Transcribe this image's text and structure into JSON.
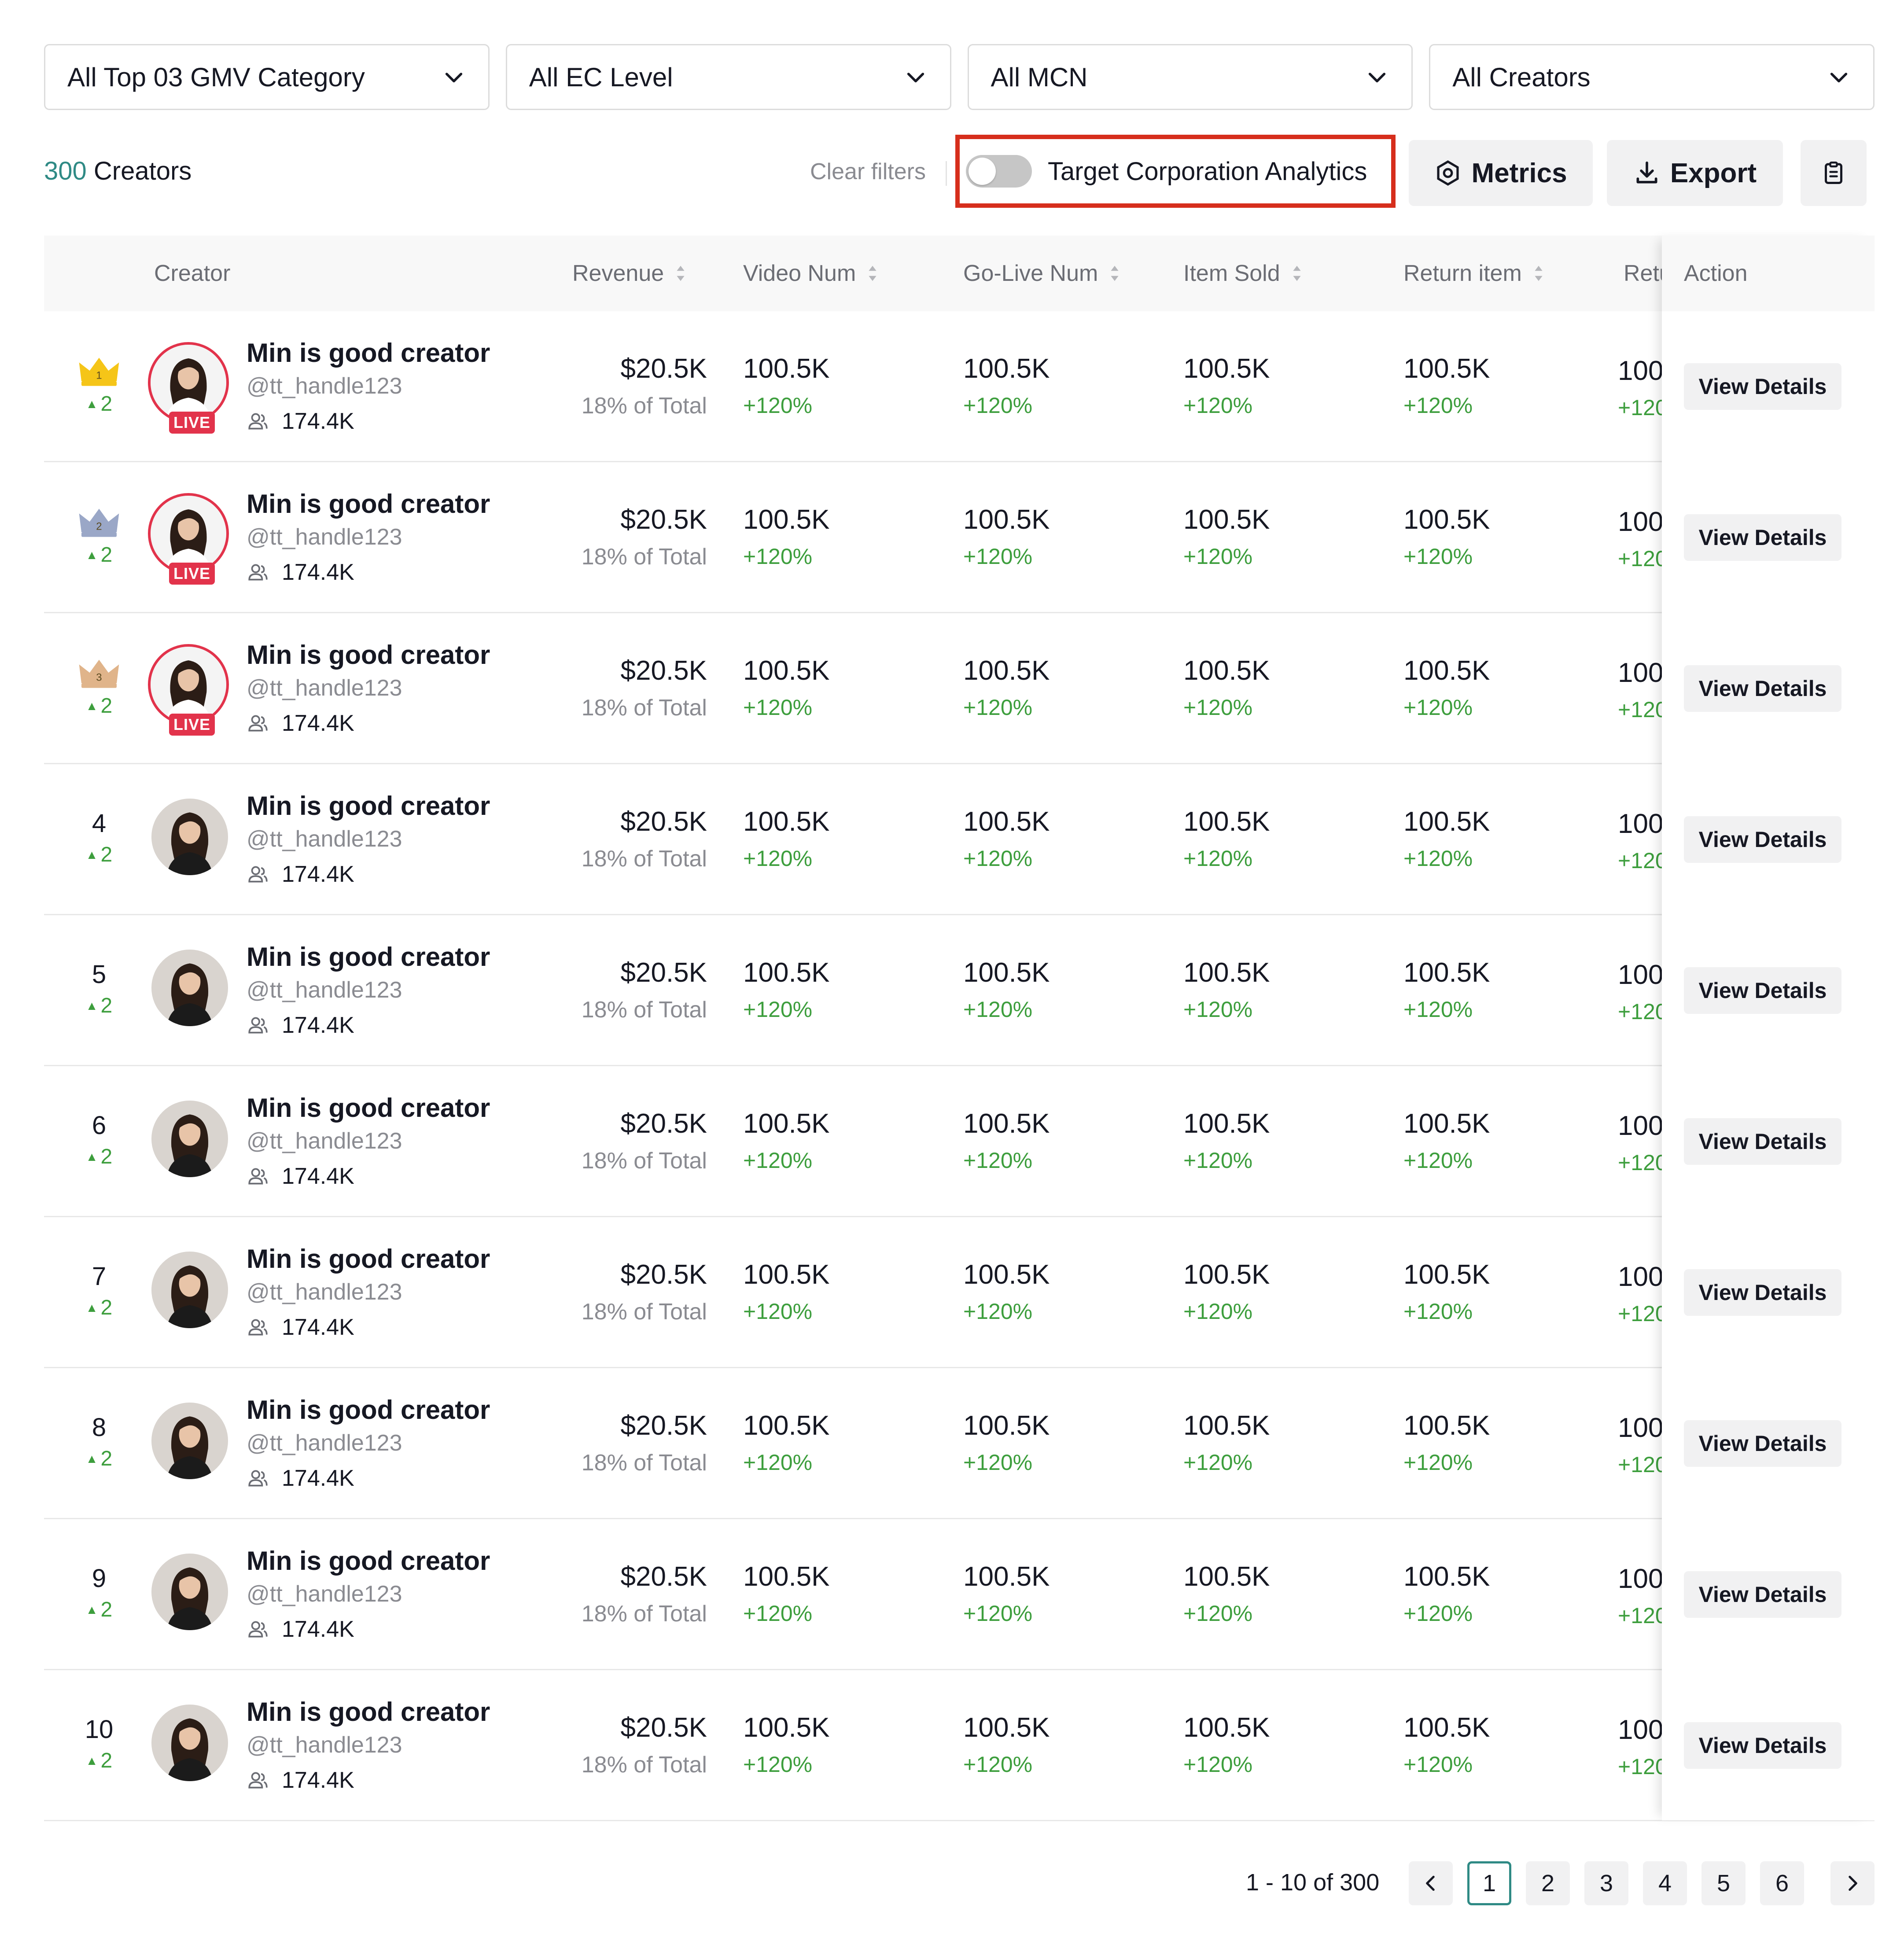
{
  "filters": [
    {
      "label": "All Top 03 GMV Category"
    },
    {
      "label": "All EC Level"
    },
    {
      "label": "All MCN"
    },
    {
      "label": "All Creators"
    }
  ],
  "toolbar": {
    "count": "300",
    "count_suffix": "Creators",
    "clear_filters": "Clear filters",
    "toggle_label": "Target Corporation Analytics",
    "toggle_on": false,
    "metrics_label": "Metrics",
    "export_label": "Export",
    "highlight_color": "#d62e1c"
  },
  "table": {
    "headers": {
      "creator": "Creator",
      "revenue": "Revenue",
      "video_num": "Video Num",
      "go_live_num": "Go-Live Num",
      "item_sold": "Item Sold",
      "return_item": "Return item",
      "return_rate": "Retu",
      "action": "Action"
    },
    "rows": [
      {
        "rank": "1",
        "crown": "gold",
        "delta": "2",
        "live": true,
        "live_label": "LIVE",
        "name": "Min is good creator",
        "handle": "@tt_handle123",
        "followers": "174.4K",
        "revenue": "$20.5K",
        "revenue_share": "18% of Total",
        "video": "100.5K",
        "video_pct": "+120%",
        "golive": "100.5K",
        "golive_pct": "+120%",
        "sold": "100.5K",
        "sold_pct": "+120%",
        "returned": "100.5K",
        "returned_pct": "+120%",
        "ret": "100",
        "ret_pct": "+120",
        "action": "View Details"
      },
      {
        "rank": "2",
        "crown": "silver",
        "delta": "2",
        "live": true,
        "live_label": "LIVE",
        "name": "Min is good creator",
        "handle": "@tt_handle123",
        "followers": "174.4K",
        "revenue": "$20.5K",
        "revenue_share": "18% of Total",
        "video": "100.5K",
        "video_pct": "+120%",
        "golive": "100.5K",
        "golive_pct": "+120%",
        "sold": "100.5K",
        "sold_pct": "+120%",
        "returned": "100.5K",
        "returned_pct": "+120%",
        "ret": "100",
        "ret_pct": "+120",
        "action": "View Details"
      },
      {
        "rank": "3",
        "crown": "bronze",
        "delta": "2",
        "live": true,
        "live_label": "LIVE",
        "name": "Min is good creator",
        "handle": "@tt_handle123",
        "followers": "174.4K",
        "revenue": "$20.5K",
        "revenue_share": "18% of Total",
        "video": "100.5K",
        "video_pct": "+120%",
        "golive": "100.5K",
        "golive_pct": "+120%",
        "sold": "100.5K",
        "sold_pct": "+120%",
        "returned": "100.5K",
        "returned_pct": "+120%",
        "ret": "100",
        "ret_pct": "+120",
        "action": "View Details"
      },
      {
        "rank": "4",
        "crown": "",
        "delta": "2",
        "live": false,
        "live_label": "",
        "name": "Min is good creator",
        "handle": "@tt_handle123",
        "followers": "174.4K",
        "revenue": "$20.5K",
        "revenue_share": "18% of Total",
        "video": "100.5K",
        "video_pct": "+120%",
        "golive": "100.5K",
        "golive_pct": "+120%",
        "sold": "100.5K",
        "sold_pct": "+120%",
        "returned": "100.5K",
        "returned_pct": "+120%",
        "ret": "100",
        "ret_pct": "+120",
        "action": "View Details"
      },
      {
        "rank": "5",
        "crown": "",
        "delta": "2",
        "live": false,
        "live_label": "",
        "name": "Min is good creator",
        "handle": "@tt_handle123",
        "followers": "174.4K",
        "revenue": "$20.5K",
        "revenue_share": "18% of Total",
        "video": "100.5K",
        "video_pct": "+120%",
        "golive": "100.5K",
        "golive_pct": "+120%",
        "sold": "100.5K",
        "sold_pct": "+120%",
        "returned": "100.5K",
        "returned_pct": "+120%",
        "ret": "100",
        "ret_pct": "+120",
        "action": "View Details"
      },
      {
        "rank": "6",
        "crown": "",
        "delta": "2",
        "live": false,
        "live_label": "",
        "name": "Min is good creator",
        "handle": "@tt_handle123",
        "followers": "174.4K",
        "revenue": "$20.5K",
        "revenue_share": "18% of Total",
        "video": "100.5K",
        "video_pct": "+120%",
        "golive": "100.5K",
        "golive_pct": "+120%",
        "sold": "100.5K",
        "sold_pct": "+120%",
        "returned": "100.5K",
        "returned_pct": "+120%",
        "ret": "100",
        "ret_pct": "+120",
        "action": "View Details"
      },
      {
        "rank": "7",
        "crown": "",
        "delta": "2",
        "live": false,
        "live_label": "",
        "name": "Min is good creator",
        "handle": "@tt_handle123",
        "followers": "174.4K",
        "revenue": "$20.5K",
        "revenue_share": "18% of Total",
        "video": "100.5K",
        "video_pct": "+120%",
        "golive": "100.5K",
        "golive_pct": "+120%",
        "sold": "100.5K",
        "sold_pct": "+120%",
        "returned": "100.5K",
        "returned_pct": "+120%",
        "ret": "100",
        "ret_pct": "+120",
        "action": "View Details"
      },
      {
        "rank": "8",
        "crown": "",
        "delta": "2",
        "live": false,
        "live_label": "",
        "name": "Min is good creator",
        "handle": "@tt_handle123",
        "followers": "174.4K",
        "revenue": "$20.5K",
        "revenue_share": "18% of Total",
        "video": "100.5K",
        "video_pct": "+120%",
        "golive": "100.5K",
        "golive_pct": "+120%",
        "sold": "100.5K",
        "sold_pct": "+120%",
        "returned": "100.5K",
        "returned_pct": "+120%",
        "ret": "100",
        "ret_pct": "+120",
        "action": "View Details"
      },
      {
        "rank": "9",
        "crown": "",
        "delta": "2",
        "live": false,
        "live_label": "",
        "name": "Min is good creator",
        "handle": "@tt_handle123",
        "followers": "174.4K",
        "revenue": "$20.5K",
        "revenue_share": "18% of Total",
        "video": "100.5K",
        "video_pct": "+120%",
        "golive": "100.5K",
        "golive_pct": "+120%",
        "sold": "100.5K",
        "sold_pct": "+120%",
        "returned": "100.5K",
        "returned_pct": "+120%",
        "ret": "100",
        "ret_pct": "+120",
        "action": "View Details"
      },
      {
        "rank": "10",
        "crown": "",
        "delta": "2",
        "live": false,
        "live_label": "",
        "name": "Min is good creator",
        "handle": "@tt_handle123",
        "followers": "174.4K",
        "revenue": "$20.5K",
        "revenue_share": "18% of Total",
        "video": "100.5K",
        "video_pct": "+120%",
        "golive": "100.5K",
        "golive_pct": "+120%",
        "sold": "100.5K",
        "sold_pct": "+120%",
        "returned": "100.5K",
        "returned_pct": "+120%",
        "ret": "100",
        "ret_pct": "+120",
        "action": "View Details"
      }
    ]
  },
  "pagination": {
    "range": "1 - 10 of 300",
    "pages": [
      "1",
      "2",
      "3",
      "4",
      "5",
      "6"
    ],
    "current": "1"
  },
  "colors": {
    "accent": "#2f8a85",
    "positive": "#3d9e3d",
    "live": "#e2334b",
    "gold": "#f5c518",
    "silver": "#9aa7c7",
    "bronze": "#e0b48a"
  }
}
